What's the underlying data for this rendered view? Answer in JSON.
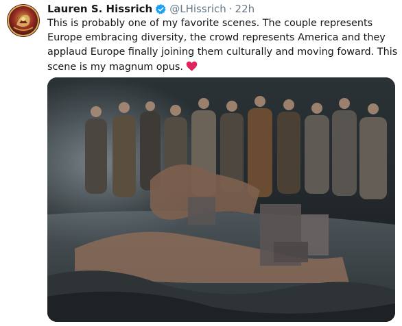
{
  "tweet": {
    "author_name": "Lauren S. Hissrich",
    "handle": "@LHissrich",
    "separator": "·",
    "time": "22h",
    "text": "This is probably one of my favorite scenes. The couple represents Europe embracing diversity, the crowd represents America and they applaud Europe finally joining them culturally and moving foward. This scene is my magnum opus.",
    "icons": {
      "verified": "verified-badge-icon",
      "emoji": "red-heart-icon"
    },
    "colors": {
      "verified": "#1da1f2",
      "heart": "#e0245e",
      "secondary_text": "#657786"
    }
  }
}
